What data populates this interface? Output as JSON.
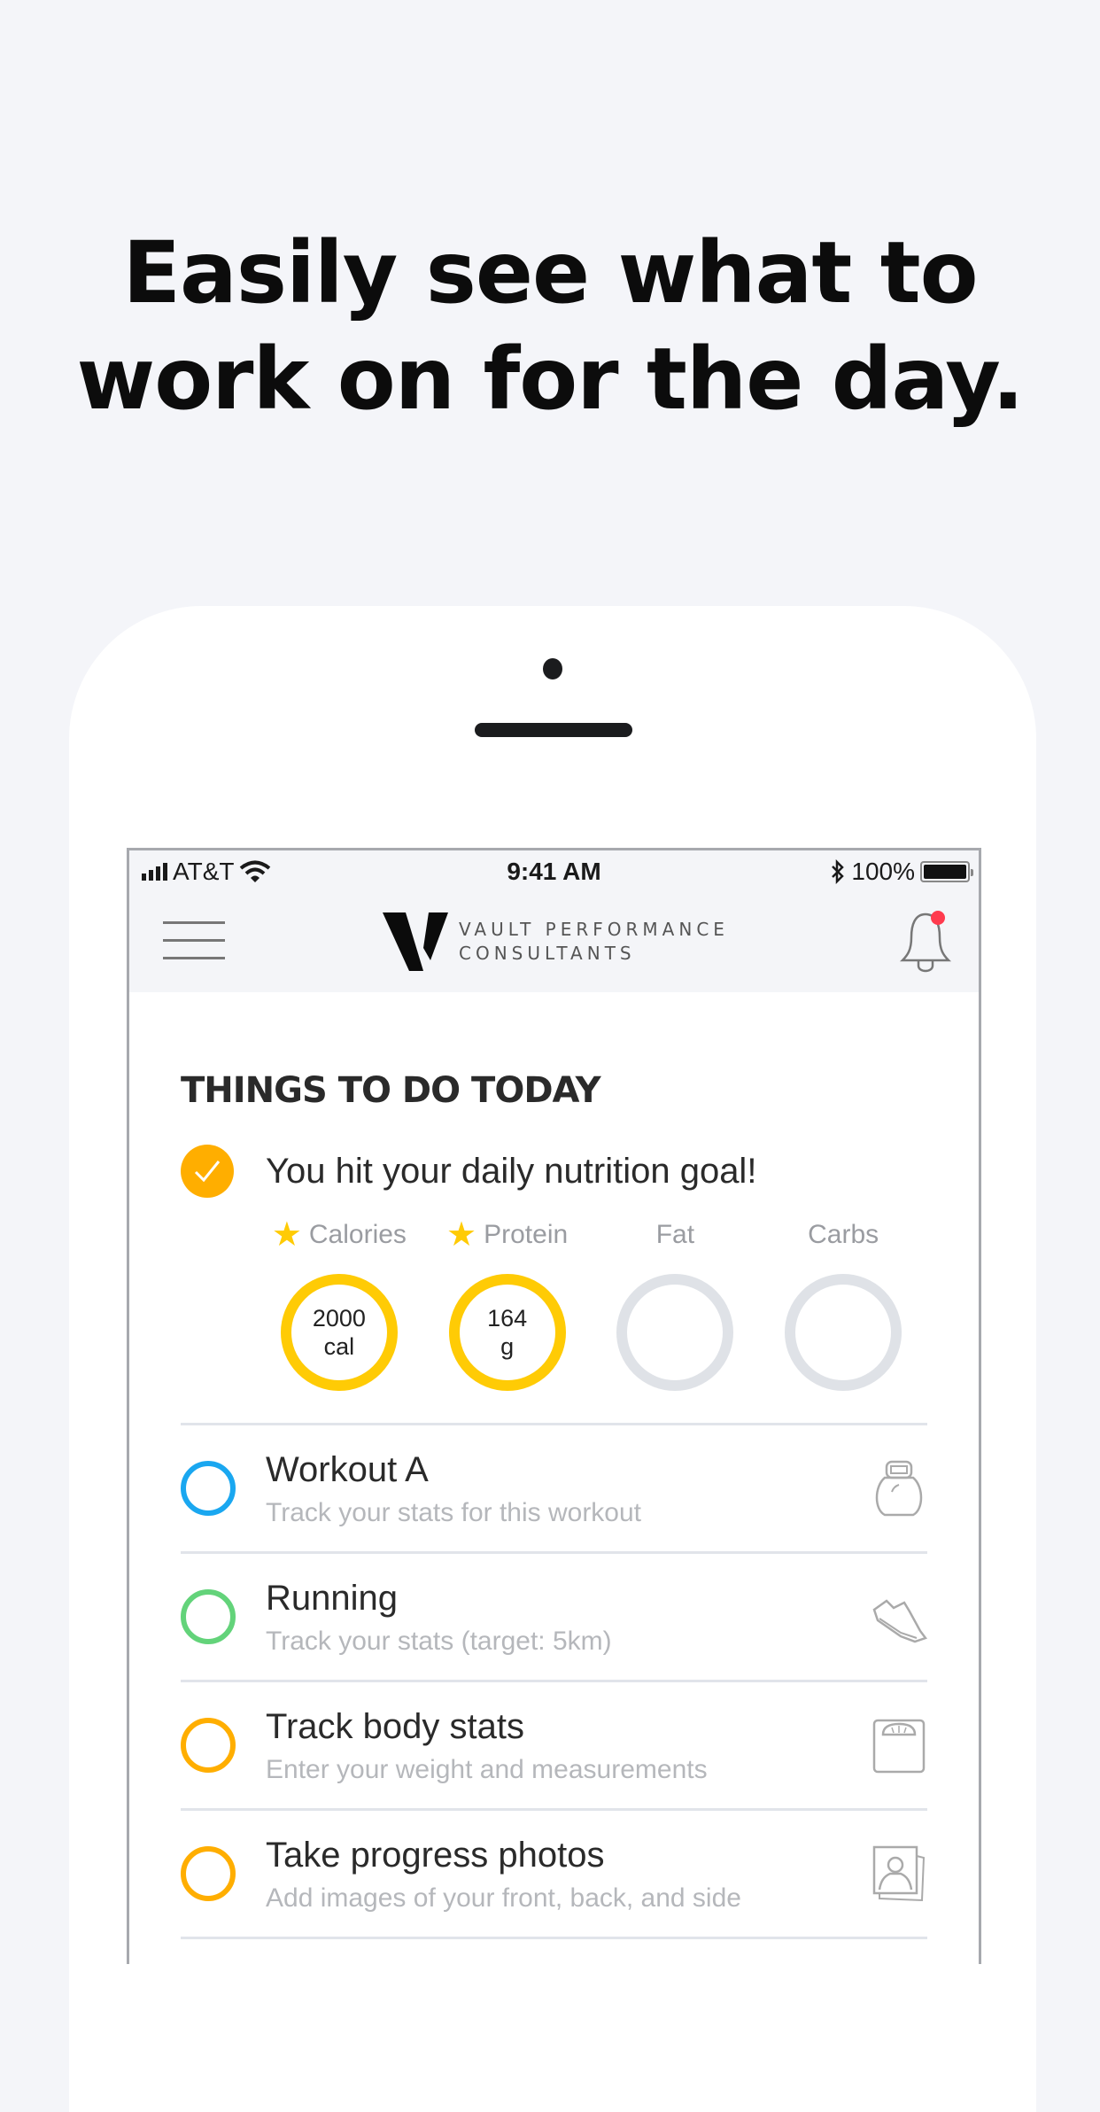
{
  "headline": {
    "line1": "Easily see what to",
    "line2": "work on for the day."
  },
  "status_bar": {
    "carrier": "AT&T",
    "time": "9:41 AM",
    "battery": "100%",
    "icons": [
      "signal-icon",
      "wifi-icon",
      "bluetooth-icon",
      "battery-icon"
    ]
  },
  "navbar": {
    "brand_line1": "VAULT PERFORMANCE",
    "brand_line2": "CONSULTANTS",
    "menu_icon": "hamburger-icon",
    "notification_icon": "bell-icon",
    "has_notification": true
  },
  "colors": {
    "accent_orange": "#ffae00",
    "goal_yellow": "#ffcb05",
    "blue": "#1aa7f0",
    "green": "#63d37a",
    "ring_empty": "#dfe2e7",
    "notification_red": "#ff3b4e"
  },
  "main": {
    "section_title": "THINGS TO DO TODAY",
    "goal_message": "You hit your daily nutrition goal!",
    "macros": [
      {
        "label": "Calories",
        "starred": true,
        "value": "2000",
        "unit": "cal",
        "complete": true
      },
      {
        "label": "Protein",
        "starred": true,
        "value": "164",
        "unit": "g",
        "complete": true
      },
      {
        "label": "Fat",
        "starred": false,
        "value": "",
        "unit": "",
        "complete": false
      },
      {
        "label": "Carbs",
        "starred": false,
        "value": "",
        "unit": "",
        "complete": false
      }
    ],
    "tasks": [
      {
        "title": "Workout A",
        "subtitle": "Track your stats for this workout",
        "color": "#1aa7f0",
        "icon": "kettlebell-icon"
      },
      {
        "title": "Running",
        "subtitle": "Track your stats (target: 5km)",
        "color": "#63d37a",
        "icon": "shoe-icon"
      },
      {
        "title": "Track body stats",
        "subtitle": "Enter your weight and measurements",
        "color": "#ffae00",
        "icon": "scale-icon"
      },
      {
        "title": "Take progress photos",
        "subtitle": "Add images of your front, back, and side",
        "color": "#ffae00",
        "icon": "photo-icon"
      }
    ]
  }
}
